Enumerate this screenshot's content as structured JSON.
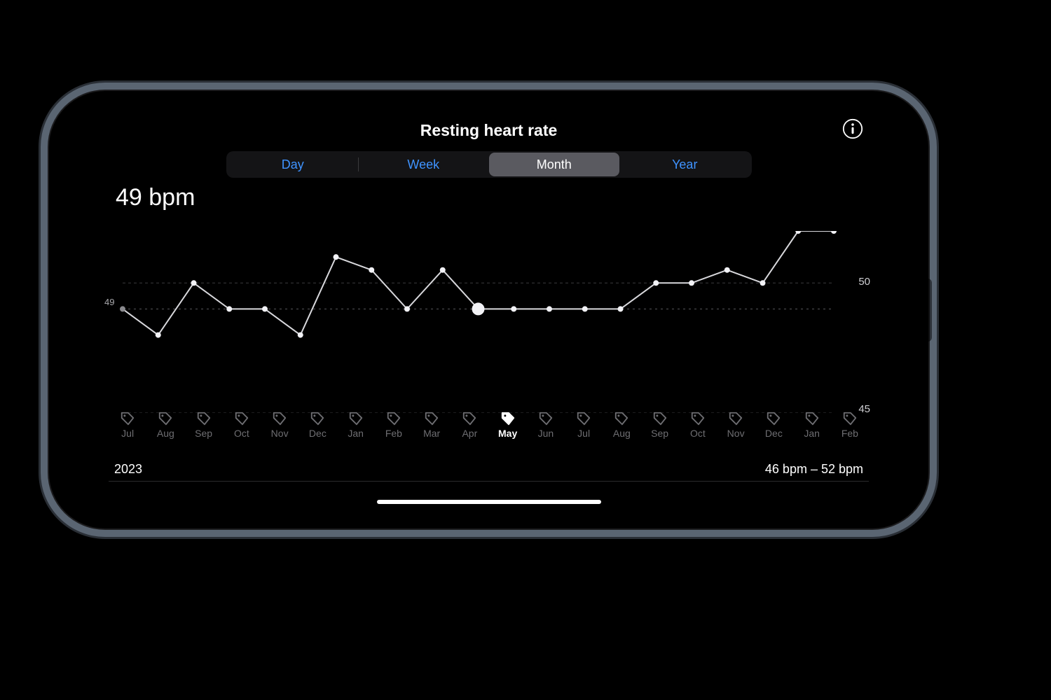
{
  "title": "Resting heart rate",
  "segments": {
    "day": "Day",
    "week": "Week",
    "month": "Month",
    "year": "Year",
    "active": "month"
  },
  "current_value_text": "49 bpm",
  "footer": {
    "year": "2023",
    "range": "46 bpm – 52 bpm"
  },
  "chart_data": {
    "type": "line",
    "title": "Resting heart rate",
    "ylabel": "bpm",
    "xlabel": "Month",
    "ylim": [
      45,
      52
    ],
    "y_ticks": [
      45,
      50
    ],
    "start_label": "49",
    "highlight_index": 10,
    "categories": [
      "Jul",
      "Aug",
      "Sep",
      "Oct",
      "Nov",
      "Dec",
      "Jan",
      "Feb",
      "Mar",
      "Apr",
      "May",
      "Jun",
      "Jul",
      "Aug",
      "Sep",
      "Oct",
      "Nov",
      "Dec",
      "Jan",
      "Feb"
    ],
    "values": [
      49,
      48,
      50,
      49,
      49,
      48,
      51,
      50.5,
      49,
      50.5,
      49,
      49,
      49,
      49,
      49,
      50,
      50,
      50.5,
      50,
      52,
      52
    ],
    "active_month": "May"
  }
}
